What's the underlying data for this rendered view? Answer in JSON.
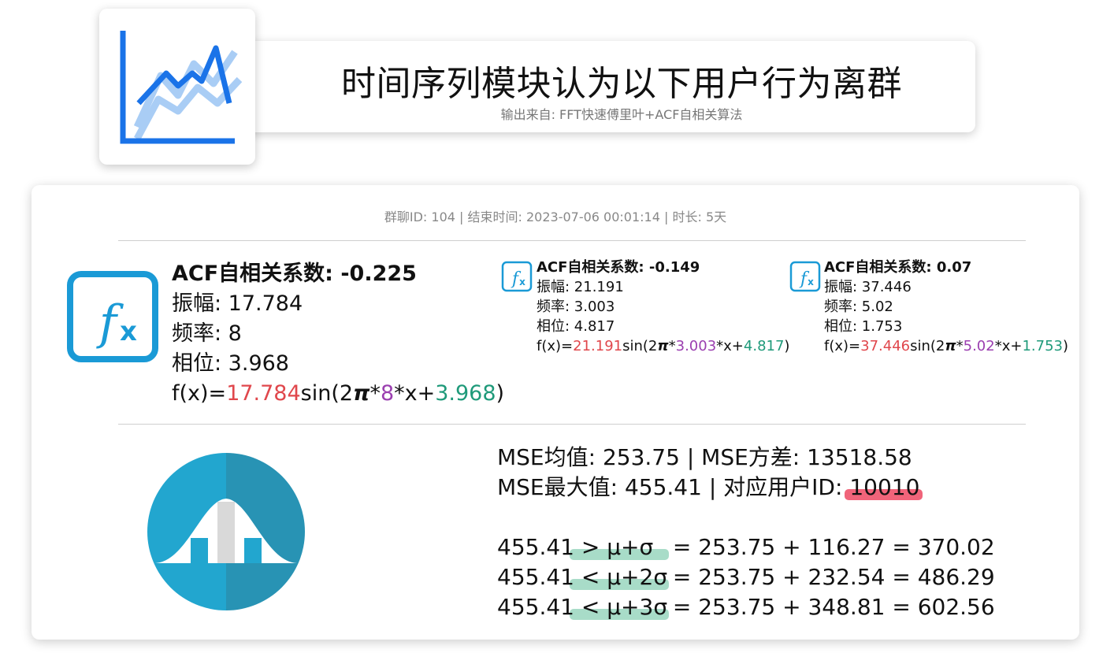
{
  "header": {
    "title": "时间序列模块认为以下用户行为离群",
    "subtitle": "输出来自: FFT快速傅里叶+ACF自相关算法",
    "logo_icon": "line-chart-icon"
  },
  "meta": {
    "text": "群聊ID: 104 | 结束时间: 2023-07-06 00:01:14 | 时长: 5天"
  },
  "components": [
    {
      "acf": "ACF自相关系数: -0.225",
      "amplitude": "振幅: 17.784",
      "frequency": "频率: 8",
      "phase": "相位: 3.968",
      "formula": {
        "prefix": "f(x)=",
        "amp": "17.784",
        "mid": "sin(2",
        "pi": "π",
        "star1": "*",
        "freq": "8",
        "x": "*x+",
        "phase": "3.968",
        "close": ")"
      }
    },
    {
      "acf": "ACF自相关系数: -0.149",
      "amplitude": "振幅: 21.191",
      "frequency": "频率: 3.003",
      "phase": "相位: 4.817",
      "formula": {
        "prefix": "f(x)=",
        "amp": "21.191",
        "mid": "sin(2",
        "pi": "π",
        "star1": "*",
        "freq": "3.003",
        "x": "*x+",
        "phase": "4.817",
        "close": ")"
      }
    },
    {
      "acf": "ACF自相关系数: 0.07",
      "amplitude": "振幅: 37.446",
      "frequency": "频率: 5.02",
      "phase": "相位: 1.753",
      "formula": {
        "prefix": "f(x)=",
        "amp": "37.446",
        "mid": "sin(2",
        "pi": "π",
        "star1": "*",
        "freq": "5.02",
        "x": "*x+",
        "phase": "1.753",
        "close": ")"
      }
    }
  ],
  "stats": {
    "line1": "MSE均值: 253.75 | MSE方差: 13518.58",
    "line2_prefix": "MSE最大值: 455.41 | 对应用户ID: ",
    "user_id": "10010",
    "ineq": [
      {
        "value": "455.41",
        "cmp": " > μ+σ ",
        "rhs": " = 253.75 + 116.27 = 370.02"
      },
      {
        "value": "455.41",
        "cmp": " < μ+2σ",
        "rhs": " = 253.75 + 232.54 = 486.29"
      },
      {
        "value": "455.41",
        "cmp": " < μ+3σ",
        "rhs": " = 253.75 + 348.81 = 602.56"
      }
    ]
  },
  "icons": {
    "formula": "function-fx-icon",
    "distribution": "normal-distribution-icon"
  },
  "colors": {
    "accent_blue": "#1a9ad6",
    "amp_red": "#e0474c",
    "freq_purple": "#9b3fb0",
    "phase_green": "#1f9a7a",
    "highlight_red": "#f0647a",
    "highlight_green": "#a8dcc8"
  }
}
